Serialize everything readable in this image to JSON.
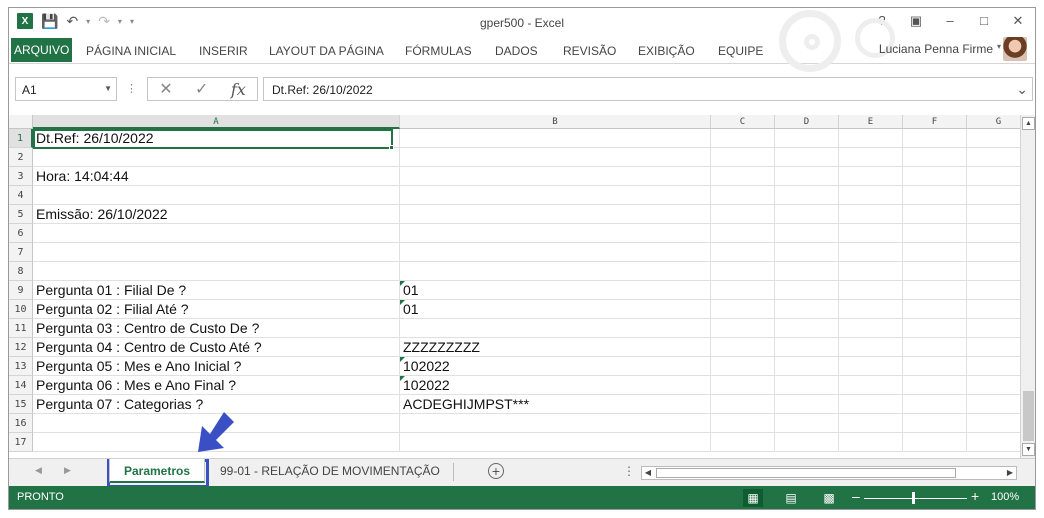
{
  "app": {
    "title": "gper500 - Excel",
    "logo": "excel-logo",
    "user": "Luciana Penna Firme"
  },
  "ribbon": {
    "tabs": [
      "ARQUIVO",
      "PÁGINA INICIAL",
      "INSERIR",
      "LAYOUT DA PÁGINA",
      "FÓRMULAS",
      "DADOS",
      "REVISÃO",
      "EXIBIÇÃO",
      "EQUIPE"
    ]
  },
  "formula_bar": {
    "name_box": "A1",
    "formula": "Dt.Ref: 26/10/2022"
  },
  "sheet": {
    "columns": [
      "A",
      "B",
      "C",
      "D",
      "E",
      "F",
      "G"
    ],
    "rows": [
      {
        "num": "1",
        "a": "Dt.Ref: 26/10/2022",
        "b": ""
      },
      {
        "num": "2",
        "a": "",
        "b": ""
      },
      {
        "num": "3",
        "a": "Hora: 14:04:44",
        "b": ""
      },
      {
        "num": "4",
        "a": "",
        "b": ""
      },
      {
        "num": "5",
        "a": "Emissão: 26/10/2022",
        "b": ""
      },
      {
        "num": "6",
        "a": "",
        "b": ""
      },
      {
        "num": "7",
        "a": "",
        "b": ""
      },
      {
        "num": "8",
        "a": "",
        "b": ""
      },
      {
        "num": "9",
        "a": "Pergunta 01 : Filial De ?",
        "b": "01"
      },
      {
        "num": "10",
        "a": "Pergunta 02 : Filial Até ?",
        "b": "01"
      },
      {
        "num": "11",
        "a": "Pergunta 03 : Centro de Custo De ?",
        "b": ""
      },
      {
        "num": "12",
        "a": "Pergunta 04 : Centro de Custo Até ?",
        "b": "ZZZZZZZZZ"
      },
      {
        "num": "13",
        "a": "Pergunta 05 : Mes e Ano Inicial ?",
        "b": "102022"
      },
      {
        "num": "14",
        "a": "Pergunta 06 : Mes e Ano Final ?",
        "b": "102022"
      },
      {
        "num": "15",
        "a": "Pergunta 07 : Categorias ?",
        "b": "ACDEGHIJMPST***"
      },
      {
        "num": "16",
        "a": "",
        "b": ""
      },
      {
        "num": "17",
        "a": "",
        "b": ""
      }
    ],
    "text_marker_rows": [
      "9",
      "10",
      "13",
      "14"
    ]
  },
  "sheet_tabs": {
    "active": "Parametros",
    "other": "99-01 - RELAÇÃO DE MOVIMENTAÇÃO"
  },
  "status_bar": {
    "status": "PRONTO",
    "zoom": "100%"
  },
  "colors": {
    "accent": "#217346",
    "highlight": "#3b4fc4"
  }
}
